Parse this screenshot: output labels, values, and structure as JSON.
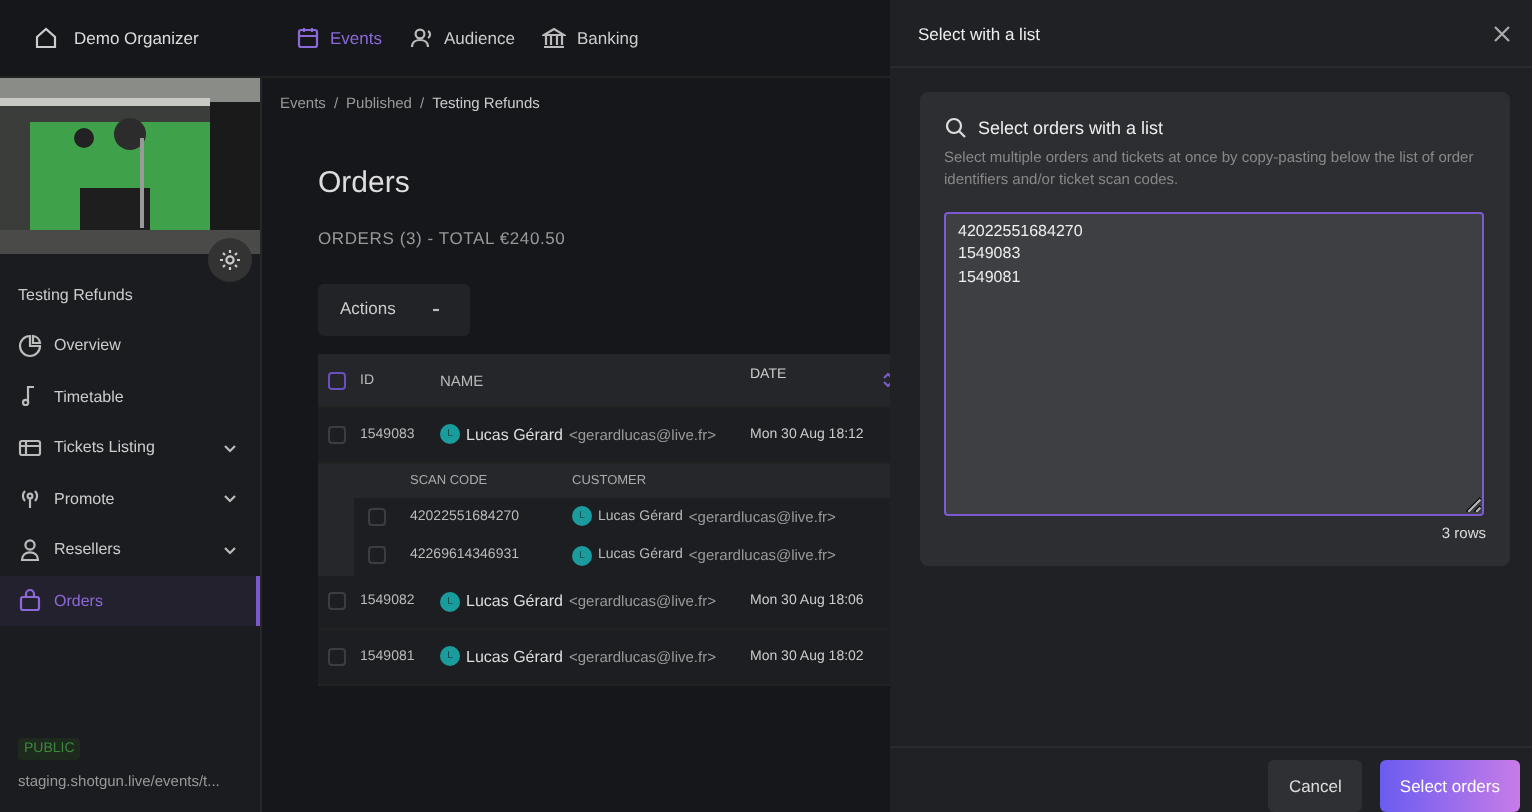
{
  "topbar": {
    "organizer": "Demo Organizer",
    "nav": [
      {
        "label": "Events",
        "selected": true
      },
      {
        "label": "Audience",
        "selected": false
      },
      {
        "label": "Banking",
        "selected": false
      }
    ]
  },
  "sidebar": {
    "event_title": "Testing Refunds",
    "items": [
      {
        "label": "Overview",
        "selected": false,
        "expandable": false
      },
      {
        "label": "Timetable",
        "selected": false,
        "expandable": false
      },
      {
        "label": "Tickets Listing",
        "selected": false,
        "expandable": true
      },
      {
        "label": "Promote",
        "selected": false,
        "expandable": true
      },
      {
        "label": "Resellers",
        "selected": false,
        "expandable": true
      },
      {
        "label": "Orders",
        "selected": true,
        "expandable": false
      }
    ],
    "status_badge": "PUBLIC",
    "url": "staging.shotgun.live/events/t..."
  },
  "breadcrumb": {
    "separator": "/",
    "items": [
      "Events",
      "Published",
      "Testing Refunds"
    ]
  },
  "page": {
    "title": "Orders",
    "summary": "ORDERS (3) - TOTAL €240.50",
    "actions_button": "Actions"
  },
  "table": {
    "all_checked": false,
    "columns": [
      "ID",
      "NAME",
      "DATE"
    ],
    "rows": [
      {
        "id": "1549083",
        "name": "Lucas Gérard",
        "email": "<gerardlucas@live.fr>",
        "date": "Mon 30 Aug 18:12",
        "avatar": "L",
        "checked": false,
        "tickets": {
          "columns": [
            "SCAN CODE",
            "CUSTOMER"
          ],
          "rows": [
            {
              "scan_code": "42022551684270",
              "name": "Lucas Gérard",
              "email": "<gerardlucas@live.fr>",
              "avatar": "L",
              "checked": false
            },
            {
              "scan_code": "42269614346931",
              "name": "Lucas Gérard",
              "email": "<gerardlucas@live.fr>",
              "avatar": "L",
              "checked": false
            }
          ]
        }
      },
      {
        "id": "1549082",
        "name": "Lucas Gérard",
        "email": "<gerardlucas@live.fr>",
        "date": "Mon 30 Aug 18:06",
        "avatar": "L",
        "checked": false
      },
      {
        "id": "1549081",
        "name": "Lucas Gérard",
        "email": "<gerardlucas@live.fr>",
        "date": "Mon 30 Aug 18:02",
        "avatar": "L",
        "checked": false
      }
    ]
  },
  "drawer": {
    "title": "Select with a list",
    "card_title": "Select orders with a list",
    "description": "Select multiple orders and tickets at once by copy-pasting below the list of order identifiers and/or ticket scan codes.",
    "value": "42022551684270\n1549083\n1549081",
    "row_count": "3 rows",
    "buttons": [
      {
        "label": "Cancel",
        "kind": "secondary"
      },
      {
        "label": "Select orders",
        "kind": "primary"
      }
    ]
  }
}
